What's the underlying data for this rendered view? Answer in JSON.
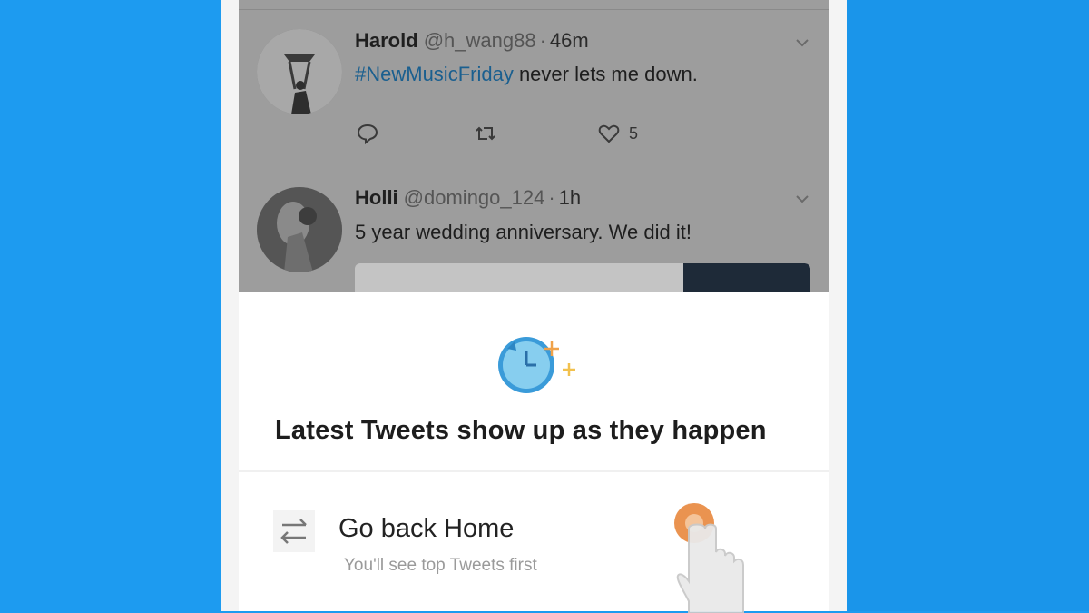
{
  "timeline": {
    "tweets": [
      {
        "name": "Harold",
        "handle": "@h_wang88",
        "separator": "·",
        "time": "46m",
        "hashtag": "#NewMusicFriday",
        "text": " never lets me down.",
        "like_count": "5"
      },
      {
        "name": "Holli",
        "handle": "@domingo_124",
        "separator": "·",
        "time": "1h",
        "text": "5 year wedding anniversary. We did it!"
      }
    ]
  },
  "sheet": {
    "title": "Latest Tweets show up as they happen",
    "option": {
      "label": "Go back Home",
      "sublabel": "You'll see top Tweets first"
    }
  },
  "colors": {
    "background": "#1d9bf0",
    "accent_clock": "#5bb7ea",
    "tap_indicator": "#e8873d"
  },
  "icons": [
    "chevron-down-icon",
    "reply-icon",
    "retweet-icon",
    "like-icon",
    "clock-icon",
    "swap-arrows-icon",
    "tap-hand-icon"
  ]
}
